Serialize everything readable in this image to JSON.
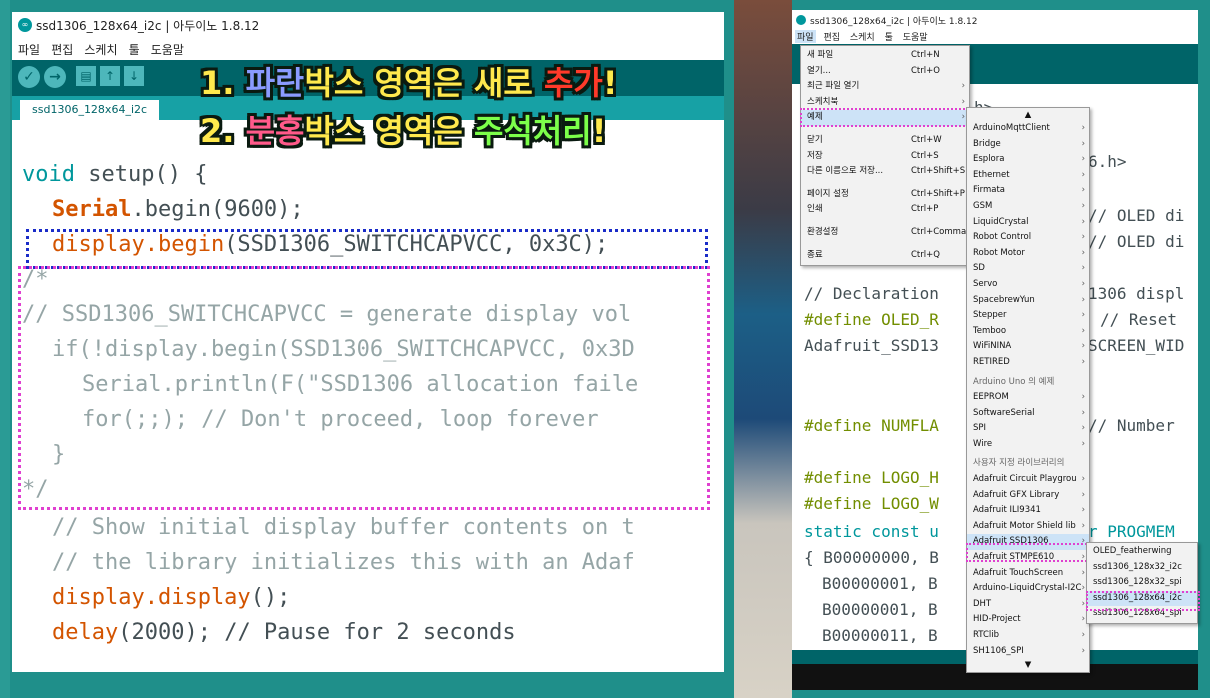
{
  "left_window": {
    "title": "ssd1306_128x64_i2c | 아두이노 1.8.12",
    "menu": [
      "파일",
      "편집",
      "스케치",
      "툴",
      "도움말"
    ],
    "tab": "ssd1306_128x64_i2c",
    "toolbar_icons": [
      "verify-icon",
      "upload-icon",
      "new-icon",
      "open-icon",
      "save-icon"
    ]
  },
  "overlay": {
    "line1": [
      "1. ",
      "파란",
      "박스 영역은 새로 ",
      "추가",
      "!"
    ],
    "line2": [
      "2. ",
      "분홍",
      "박스 영역은 ",
      "주석처리",
      "!"
    ]
  },
  "code_left": [
    [
      "void",
      " setup() {"
    ],
    [
      "Serial",
      ".begin(9600);"
    ],
    [
      "display.begin",
      "(SSD1306_SWITCHCAPVCC, 0x3C);"
    ],
    [
      "/*"
    ],
    [
      "// SSD1306_SWITCHCAPVCC = generate display vol"
    ],
    [
      "if(!display.begin(SSD1306_SWITCHCAPVCC, 0x3D"
    ],
    [
      "Serial.println(F(\"SSD1306 allocation faile"
    ],
    [
      "for(;;); // Don't proceed, loop forever"
    ],
    [
      "}"
    ],
    [
      "*/"
    ],
    [
      "// Show initial display buffer contents on t"
    ],
    [
      "// the library initializes this with an Adaf"
    ],
    [
      "display.display",
      "();"
    ],
    [
      "delay",
      "(2000); // Pause for 2 seconds"
    ]
  ],
  "right_window": {
    "title": "ssd1306_128x64_i2c | 아두이노 1.8.12",
    "menu": [
      "파일",
      "편집",
      "스케치",
      "툴",
      "도움말"
    ],
    "code_lines": [
      "h>",
      "6.h>",
      "// OLED di",
      "// OLED di",
      "// Declaration",
      "1306 displ",
      "#define OLED_R",
      "// Reset",
      "Adafruit_SSD13",
      "SCREEN_WID",
      "#define NUMFLA",
      "// Number",
      "#define LOGO_H",
      "#define LOGO_W",
      "static const u",
      "r PROGMEM",
      "{ B00000000, B",
      "B00000001, B",
      "B00000001, B",
      "B00000011, B"
    ],
    "file_menu": [
      {
        "label": "새 파일",
        "shortcut": "Ctrl+N"
      },
      {
        "label": "열기...",
        "shortcut": "Ctrl+O"
      },
      {
        "label": "최근 파일 열기",
        "arrow": "›"
      },
      {
        "label": "스케치북",
        "arrow": "›"
      },
      {
        "label": "예제",
        "arrow": "›",
        "highlight": true
      },
      {
        "label": "닫기",
        "shortcut": "Ctrl+W"
      },
      {
        "label": "저장",
        "shortcut": "Ctrl+S"
      },
      {
        "label": "다른 이름으로 저장...",
        "shortcut": "Ctrl+Shift+S"
      },
      {
        "label": "페이지 설정",
        "shortcut": "Ctrl+Shift+P"
      },
      {
        "label": "인쇄",
        "shortcut": "Ctrl+P"
      },
      {
        "label": "환경설정",
        "shortcut": "Ctrl+Comma"
      },
      {
        "label": "종료",
        "shortcut": "Ctrl+Q"
      }
    ],
    "examples_menu_top": "▲",
    "examples_menu_bottom": "▼",
    "examples_menu": [
      "ArduinoMqttClient",
      "Bridge",
      "Esplora",
      "Ethernet",
      "Firmata",
      "GSM",
      "LiquidCrystal",
      "Robot Control",
      "Robot Motor",
      "SD",
      "Servo",
      "SpacebrewYun",
      "Stepper",
      "Temboo",
      "WiFiNINA",
      "RETIRED"
    ],
    "examples_header_board": "Arduino Uno 의 예제",
    "examples_board": [
      "EEPROM",
      "SoftwareSerial",
      "SPI",
      "Wire"
    ],
    "examples_header_user": "사용자 지정 라이브러리의",
    "examples_user": [
      "Adafruit Circuit Playgrou",
      "Adafruit GFX Library",
      "Adafruit ILI9341",
      "Adafruit Motor Shield lib",
      "Adafruit SSD1306",
      "Adafruit STMPE610",
      "Adafruit TouchScreen",
      "Arduino-LiquidCrystal-I2C",
      "DHT",
      "HID-Project",
      "RTClib",
      "SH1106_SPI"
    ],
    "ssd1306_menu": [
      "OLED_featherwing",
      "ssd1306_128x32_i2c",
      "ssd1306_128x32_spi",
      "ssd1306_128x64_i2c",
      "ssd1306_128x64_spi"
    ],
    "arrow_symbol": "›"
  },
  "colors": {
    "teal_dark": "#006468",
    "teal_tab": "#17a1a5",
    "keyword": "#00979c",
    "object": "#d35400",
    "comment": "#95a5a6",
    "blue_box": "#1a2cc8",
    "pink_box": "#e040d0",
    "menu_highlight": "#cde3f7"
  }
}
